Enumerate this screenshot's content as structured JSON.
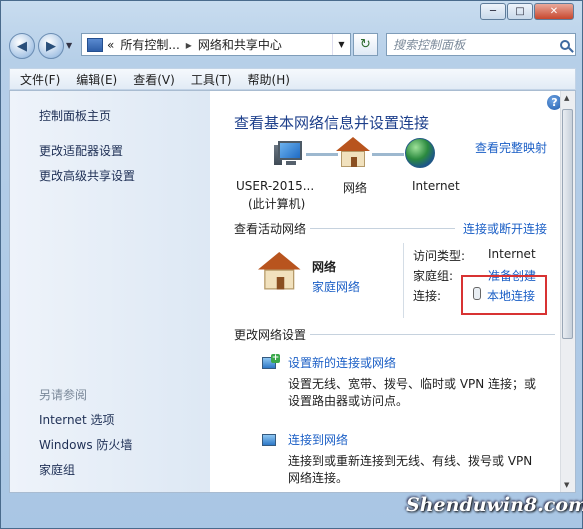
{
  "window": {
    "minimize": "─",
    "maximize": "□",
    "close": "✕"
  },
  "nav": {
    "back_glyph": "◀",
    "forward_glyph": "▶",
    "dropdown_glyph": "▼",
    "breadcrumb": [
      "所有控制...",
      "网络和共享中心"
    ],
    "breadcrumb_prefix": "«",
    "sep": "▸",
    "refresh_glyph": "↻",
    "search_placeholder": "搜索控制面板"
  },
  "menu": [
    "文件(F)",
    "编辑(E)",
    "查看(V)",
    "工具(T)",
    "帮助(H)"
  ],
  "sidebar": {
    "links": [
      "控制面板主页",
      "更改适配器设置",
      "更改高级共享设置"
    ],
    "see_also_header": "另请参阅",
    "see_also": [
      "Internet 选项",
      "Windows 防火墙",
      "家庭组"
    ]
  },
  "main": {
    "help_glyph": "?",
    "title": "查看基本网络信息并设置连接",
    "full_map_link": "查看完整映射",
    "map": {
      "computer_line1": "USER-2015...",
      "computer_line2": "(此计算机)",
      "network": "网络",
      "internet": "Internet"
    },
    "active_header": "查看活动网络",
    "connect_link": "连接或断开连接",
    "network_name": "网络",
    "network_type": "家庭网络",
    "access_type_label": "访问类型:",
    "access_type_value": "Internet",
    "homegroup_label": "家庭组:",
    "homegroup_value": "准备创建",
    "connections_label": "连接:",
    "connections_value": "本地连接",
    "change_header": "更改网络设置",
    "tasks": [
      {
        "title": "设置新的连接或网络",
        "desc1": "设置无线、宽带、拨号、临时或 VPN 连接；或",
        "desc2": "设置路由器或访问点。"
      },
      {
        "title": "连接到网络",
        "desc1": "连接到或重新连接到无线、有线、拨号或 VPN",
        "desc2": "网络连接。"
      }
    ]
  },
  "watermark": "Shenduwin8.com",
  "colors": {
    "link": "#1b5fc6",
    "title": "#1d3f8b",
    "highlight_box": "#d83333"
  }
}
